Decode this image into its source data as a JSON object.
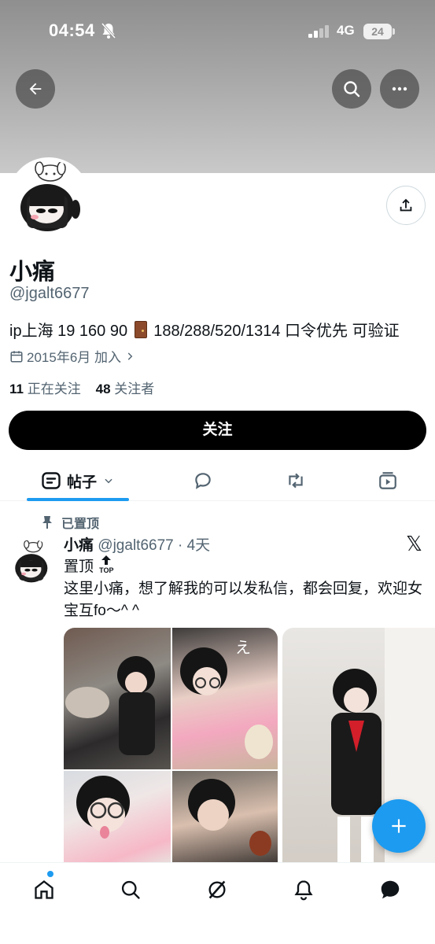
{
  "status_bar": {
    "time": "04:54",
    "network": "4G",
    "battery": "24"
  },
  "header": {
    "back_icon": "arrow-left-icon",
    "search_icon": "search-icon",
    "more_icon": "more-icon",
    "banner_color": "#a8a8a8"
  },
  "profile": {
    "name": "小痛",
    "handle": "@jgalt6677",
    "bio_prefix": "ip上海 19 160 90",
    "bio_suffix": "188/288/520/1314 口令优先 可验证",
    "joined": "2015年6月 加入",
    "following_count": "11",
    "following_label": "正在关注",
    "followers_count": "48",
    "followers_label": "关注者",
    "follow_button": "关注"
  },
  "tabs": {
    "posts_label": "帖子",
    "accent": "#1d9bf0"
  },
  "post": {
    "pinned_label": "已置顶",
    "author_name": "小痛",
    "author_handle": "@jgalt6677",
    "time": "· 4天",
    "pin_title": "置顶",
    "top_badge": "TOP",
    "text": "这里小痛，想了解我的可以发私信，都会回复，欢迎女宝互fo～^ ^"
  },
  "colors": {
    "primary": "#1d9bf0",
    "text": "#0f1419",
    "secondary": "#536471",
    "button": "#000000"
  }
}
